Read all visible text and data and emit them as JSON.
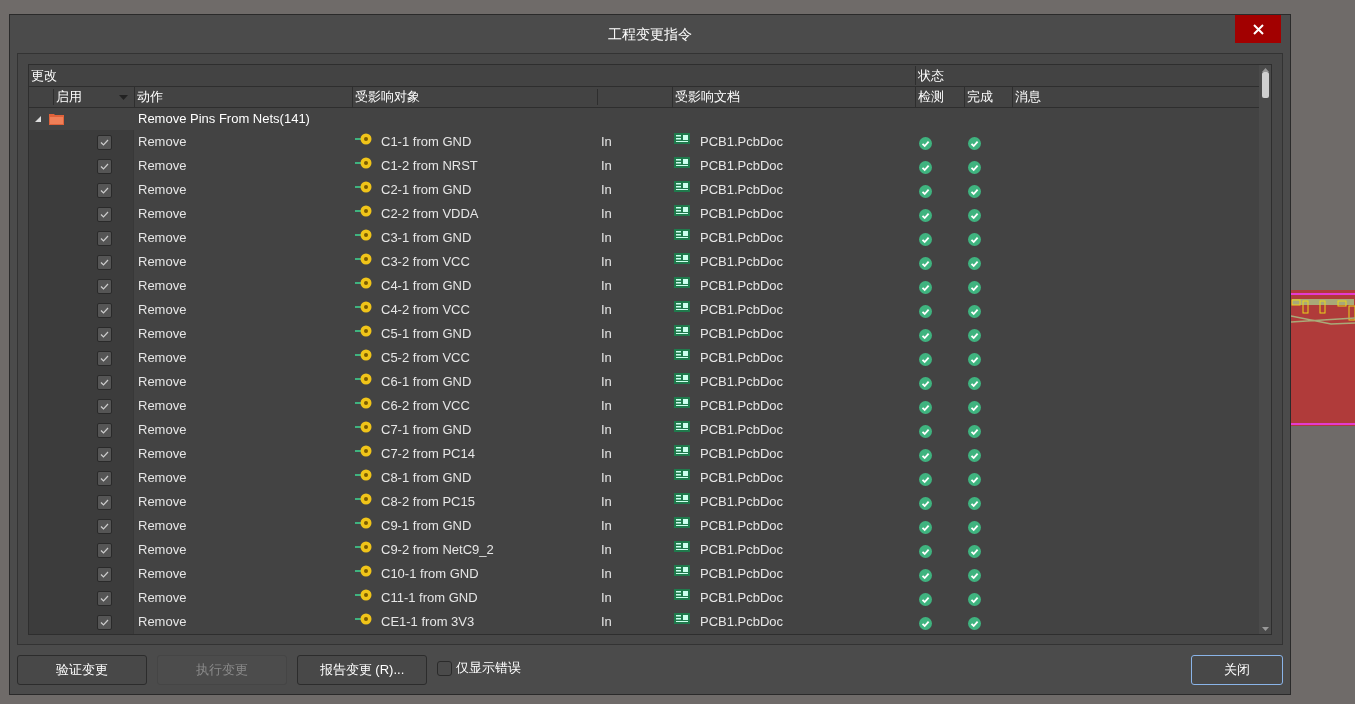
{
  "window": {
    "title": "工程变更指令"
  },
  "table": {
    "group_headers": [
      "更改",
      "状态"
    ],
    "columns": [
      "启用",
      "动作",
      "受影响对象",
      "受影响文档",
      "检测",
      "完成",
      "消息"
    ],
    "group": {
      "label": "Remove Pins From Nets(141)",
      "expanded": true
    },
    "rows": [
      {
        "checked": true,
        "action": "Remove",
        "object": "C1-1 from GND",
        "direction": "In",
        "document": "PCB1.PcbDoc",
        "check_passed": true,
        "done_passed": true
      },
      {
        "checked": true,
        "action": "Remove",
        "object": "C1-2 from NRST",
        "direction": "In",
        "document": "PCB1.PcbDoc",
        "check_passed": true,
        "done_passed": true
      },
      {
        "checked": true,
        "action": "Remove",
        "object": "C2-1 from GND",
        "direction": "In",
        "document": "PCB1.PcbDoc",
        "check_passed": true,
        "done_passed": true
      },
      {
        "checked": true,
        "action": "Remove",
        "object": "C2-2 from VDDA",
        "direction": "In",
        "document": "PCB1.PcbDoc",
        "check_passed": true,
        "done_passed": true
      },
      {
        "checked": true,
        "action": "Remove",
        "object": "C3-1 from GND",
        "direction": "In",
        "document": "PCB1.PcbDoc",
        "check_passed": true,
        "done_passed": true
      },
      {
        "checked": true,
        "action": "Remove",
        "object": "C3-2 from VCC",
        "direction": "In",
        "document": "PCB1.PcbDoc",
        "check_passed": true,
        "done_passed": true
      },
      {
        "checked": true,
        "action": "Remove",
        "object": "C4-1 from GND",
        "direction": "In",
        "document": "PCB1.PcbDoc",
        "check_passed": true,
        "done_passed": true
      },
      {
        "checked": true,
        "action": "Remove",
        "object": "C4-2 from VCC",
        "direction": "In",
        "document": "PCB1.PcbDoc",
        "check_passed": true,
        "done_passed": true
      },
      {
        "checked": true,
        "action": "Remove",
        "object": "C5-1 from GND",
        "direction": "In",
        "document": "PCB1.PcbDoc",
        "check_passed": true,
        "done_passed": true
      },
      {
        "checked": true,
        "action": "Remove",
        "object": "C5-2 from VCC",
        "direction": "In",
        "document": "PCB1.PcbDoc",
        "check_passed": true,
        "done_passed": true
      },
      {
        "checked": true,
        "action": "Remove",
        "object": "C6-1 from GND",
        "direction": "In",
        "document": "PCB1.PcbDoc",
        "check_passed": true,
        "done_passed": true
      },
      {
        "checked": true,
        "action": "Remove",
        "object": "C6-2 from VCC",
        "direction": "In",
        "document": "PCB1.PcbDoc",
        "check_passed": true,
        "done_passed": true
      },
      {
        "checked": true,
        "action": "Remove",
        "object": "C7-1 from GND",
        "direction": "In",
        "document": "PCB1.PcbDoc",
        "check_passed": true,
        "done_passed": true
      },
      {
        "checked": true,
        "action": "Remove",
        "object": "C7-2 from PC14",
        "direction": "In",
        "document": "PCB1.PcbDoc",
        "check_passed": true,
        "done_passed": true
      },
      {
        "checked": true,
        "action": "Remove",
        "object": "C8-1 from GND",
        "direction": "In",
        "document": "PCB1.PcbDoc",
        "check_passed": true,
        "done_passed": true
      },
      {
        "checked": true,
        "action": "Remove",
        "object": "C8-2 from PC15",
        "direction": "In",
        "document": "PCB1.PcbDoc",
        "check_passed": true,
        "done_passed": true
      },
      {
        "checked": true,
        "action": "Remove",
        "object": "C9-1 from GND",
        "direction": "In",
        "document": "PCB1.PcbDoc",
        "check_passed": true,
        "done_passed": true
      },
      {
        "checked": true,
        "action": "Remove",
        "object": "C9-2 from NetC9_2",
        "direction": "In",
        "document": "PCB1.PcbDoc",
        "check_passed": true,
        "done_passed": true
      },
      {
        "checked": true,
        "action": "Remove",
        "object": "C10-1 from GND",
        "direction": "In",
        "document": "PCB1.PcbDoc",
        "check_passed": true,
        "done_passed": true
      },
      {
        "checked": true,
        "action": "Remove",
        "object": "C11-1 from GND",
        "direction": "In",
        "document": "PCB1.PcbDoc",
        "check_passed": true,
        "done_passed": true
      },
      {
        "checked": true,
        "action": "Remove",
        "object": "CE1-1 from 3V3",
        "direction": "In",
        "document": "PCB1.PcbDoc",
        "check_passed": true,
        "done_passed": true
      }
    ]
  },
  "buttons": [
    {
      "label": "验证变更",
      "disabled": false,
      "focused": false
    },
    {
      "label": "执行变更",
      "disabled": true,
      "focused": false
    },
    {
      "label": "报告变更 (R)...",
      "disabled": false,
      "focused": false
    }
  ],
  "errors_only": {
    "label": "仅显示错误",
    "checked": false
  },
  "close_button": {
    "label": "关闭",
    "disabled": false,
    "focused": true
  }
}
